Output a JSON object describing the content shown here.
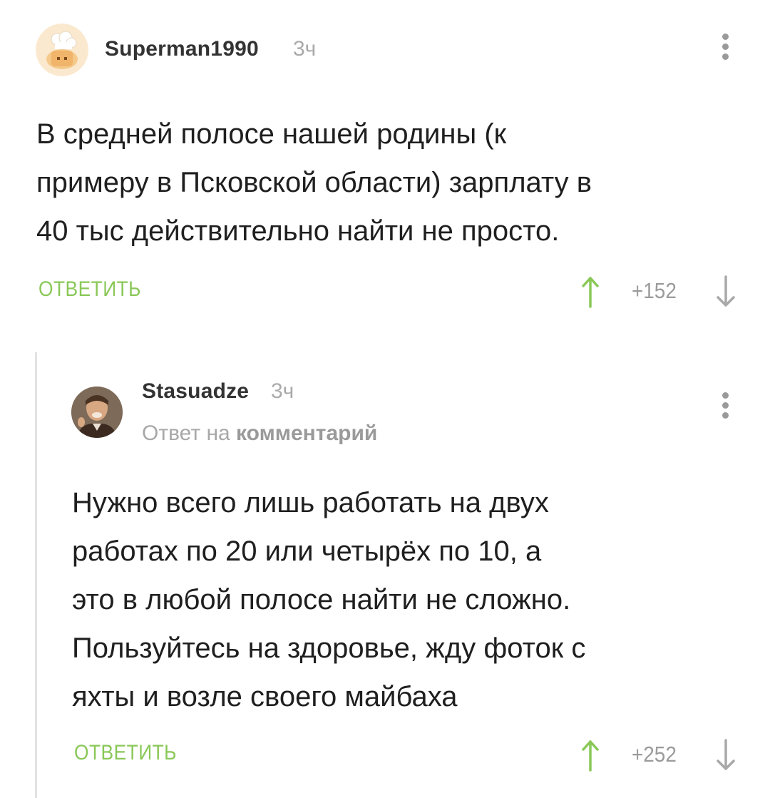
{
  "comments": [
    {
      "username": "Superman1990",
      "time": "3ч",
      "text": "В средней полосе нашей родины (к\nпримеру в Псковской области) зарплату в\n40 тыс действительно найти не просто.",
      "reply_label": "ОТВЕТИТЬ",
      "rating": "+152",
      "avatar_icon": "chef-hat-avatar-icon"
    },
    {
      "username": "Stasuadze",
      "time": "3ч",
      "reply_to_prefix": "Ответ на",
      "reply_to_target": "комментарий",
      "text": "Нужно всего лишь работать на двух\nработах по 20 или четырёх по 10, а\nэто в любой полосе найти не сложно.\nПользуйтесь на здоровье, жду фоток с\nяхты и возле своего майбаха",
      "reply_label": "ОТВЕТИТЬ",
      "rating": "+252",
      "avatar_icon": "laughing-man-avatar-icon"
    }
  ],
  "colors": {
    "accent_green": "#8ac858",
    "muted_gray": "#9b9b9b",
    "thread_line": "#e2e2e2"
  }
}
